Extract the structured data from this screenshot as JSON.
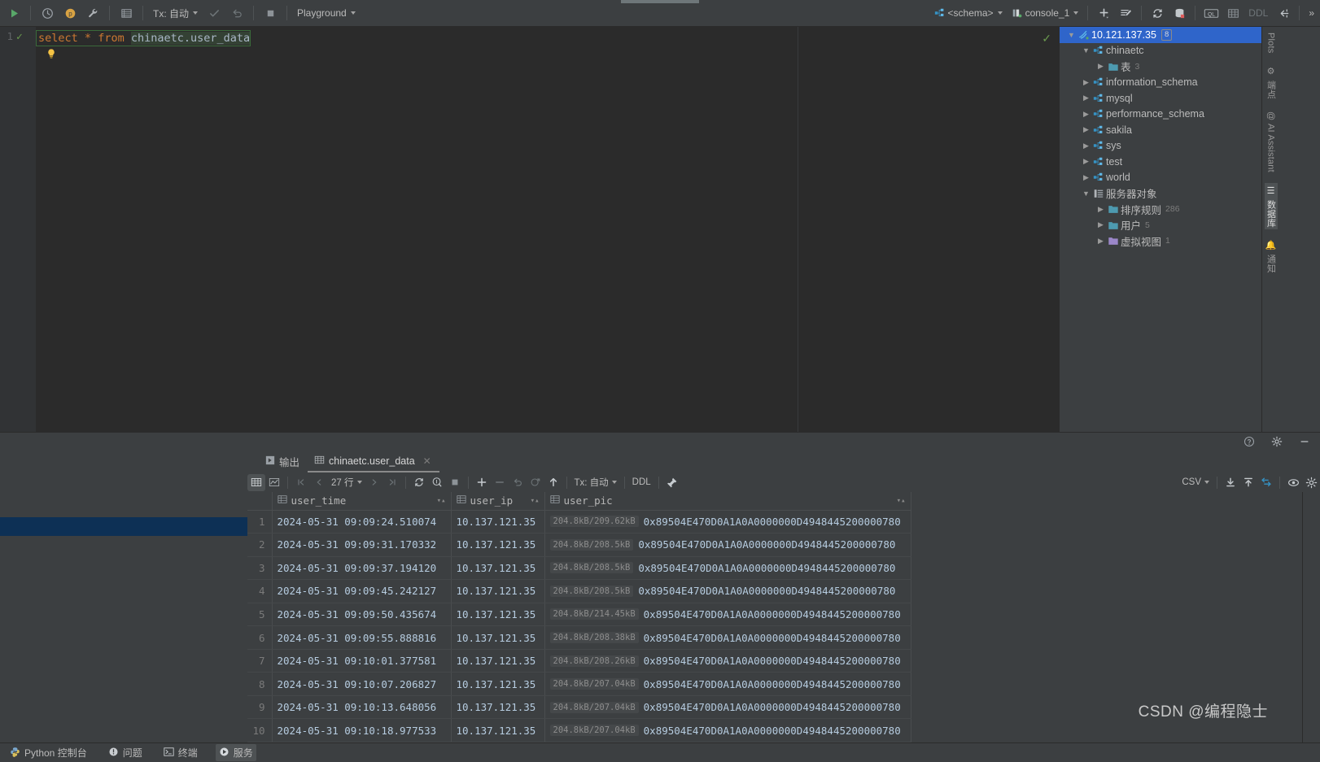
{
  "colors": {
    "accent_blue": "#2f65ca",
    "panel_bg": "#3c3f41",
    "editor_bg": "#2b2b2b",
    "selection_row": "#0d3055",
    "keyword_orange": "#cc7832",
    "text": "#bbbbbb",
    "green_ok": "#6a9a4e",
    "blue_icon": "#3592c4"
  },
  "toolbar": {
    "run_icon": "run-icon",
    "history_icon": "history-icon",
    "profiler_icon": "profiler-icon",
    "wrench_icon": "wrench-icon",
    "table_icon": "data-editor-icon",
    "tx_label": "Tx: 自动",
    "commit_icon": "commit-icon",
    "rollback_icon": "rollback-icon",
    "stop_icon": "stop-icon",
    "session_label": "Playground",
    "schema_label": "<schema>",
    "console_label": "console_1",
    "add_icon": "add-icon",
    "query_icon": "new-query-icon",
    "sync_icon": "refresh-icon",
    "db_icon": "database-icon",
    "ql_icon": "ql-icon",
    "grid_icon": "grid-icon",
    "ddl_label": "DDL",
    "jump_icon": "jump-to-console-icon",
    "more_label": "»"
  },
  "editor": {
    "line_number": "1",
    "code": {
      "kw_select": "select",
      "star": "*",
      "kw_from": "from",
      "table": "chinaetc.user_data"
    },
    "bulb_icon": "intention-bulb-icon",
    "inspection_ok_icon": "inspection-ok-icon"
  },
  "db_tree": {
    "root": {
      "label": "10.121.137.35",
      "badge": "8",
      "icon": "datasource-mysql-icon",
      "expanded": true
    },
    "items": [
      {
        "label": "chinaetc",
        "icon": "schema-icon",
        "indent": 1,
        "expanded": true,
        "count": ""
      },
      {
        "label": "表",
        "icon": "folder-icon",
        "indent": 2,
        "expanded": false,
        "count": "3"
      },
      {
        "label": "information_schema",
        "icon": "schema-icon",
        "indent": 1,
        "expanded": false,
        "count": ""
      },
      {
        "label": "mysql",
        "icon": "schema-icon",
        "indent": 1,
        "expanded": false,
        "count": ""
      },
      {
        "label": "performance_schema",
        "icon": "schema-icon",
        "indent": 1,
        "expanded": false,
        "count": ""
      },
      {
        "label": "sakila",
        "icon": "schema-icon",
        "indent": 1,
        "expanded": false,
        "count": ""
      },
      {
        "label": "sys",
        "icon": "schema-icon",
        "indent": 1,
        "expanded": false,
        "count": ""
      },
      {
        "label": "test",
        "icon": "schema-icon",
        "indent": 1,
        "expanded": false,
        "count": ""
      },
      {
        "label": "world",
        "icon": "schema-icon",
        "indent": 1,
        "expanded": false,
        "count": ""
      },
      {
        "label": "服务器对象",
        "icon": "server-objects-icon",
        "indent": 1,
        "expanded": true,
        "count": ""
      },
      {
        "label": "排序规则",
        "icon": "folder-icon",
        "indent": 2,
        "expanded": false,
        "count": "286"
      },
      {
        "label": "用户",
        "icon": "folder-icon",
        "indent": 2,
        "expanded": false,
        "count": "5"
      },
      {
        "label": "虚拟视图",
        "icon": "folder-purple-icon",
        "indent": 2,
        "expanded": false,
        "count": "1"
      }
    ]
  },
  "right_strip": [
    {
      "label": "Plots",
      "icon": "plots-icon",
      "active": false
    },
    {
      "label": "端点",
      "icon": "endpoints-icon",
      "active": false
    },
    {
      "label": "AI Assistant",
      "icon": "ai-icon",
      "active": false
    },
    {
      "label": "数据库",
      "icon": "database-icon",
      "active": true
    },
    {
      "label": "通知",
      "icon": "notification-icon",
      "active": false
    }
  ],
  "bottom_panel": {
    "settings_icon": "settings-gear-icon",
    "help_icon": "help-icon",
    "minimize_icon": "minimize-icon",
    "tabs": [
      {
        "label": "输出",
        "icon": "output-icon",
        "active": false,
        "closable": false
      },
      {
        "label": "chinaetc.user_data",
        "icon": "table-icon",
        "active": true,
        "closable": true
      }
    ],
    "grid_toolbar": {
      "grid_view_icon": "grid-view-icon",
      "chart_view_icon": "chart-view-icon",
      "first_page_icon": "first-page-icon",
      "prev_page_icon": "prev-page-icon",
      "rows_label": "27 行",
      "next_page_icon": "next-page-icon",
      "last_page_icon": "last-page-icon",
      "reload_icon": "reload-icon",
      "page_size_icon": "page-size-icon",
      "stop_icon": "stop-icon",
      "add_row_icon": "add-row-icon",
      "delete_row_icon": "delete-row-icon",
      "revert_icon": "revert-icon",
      "revert_selected_icon": "revert-selected-icon",
      "submit_icon": "submit-icon",
      "tx_label": "Tx: 自动",
      "ddl_label": "DDL",
      "pin_icon": "pin-icon",
      "format_label": "CSV",
      "export_icon": "export-icon",
      "import_icon": "import-icon",
      "compare_icon": "compare-icon",
      "view_icon": "view-options-icon",
      "settings_icon": "grid-settings-icon"
    },
    "table": {
      "columns": [
        {
          "name": "user_time",
          "icon": "column-icon",
          "sortable": true
        },
        {
          "name": "user_ip",
          "icon": "column-icon",
          "sortable": true
        },
        {
          "name": "user_pic",
          "icon": "column-icon",
          "sortable": false
        }
      ],
      "rows": [
        {
          "n": "1",
          "user_time": "2024-05-31 09:09:24.510074",
          "user_ip": "10.137.121.35",
          "pic_size": "204.8kB/209.62kB",
          "pic_hex": "0x89504E470D0A1A0A0000000D4948445200000780"
        },
        {
          "n": "2",
          "user_time": "2024-05-31 09:09:31.170332",
          "user_ip": "10.137.121.35",
          "pic_size": "204.8kB/208.5kB",
          "pic_hex": "0x89504E470D0A1A0A0000000D4948445200000780"
        },
        {
          "n": "3",
          "user_time": "2024-05-31 09:09:37.194120",
          "user_ip": "10.137.121.35",
          "pic_size": "204.8kB/208.5kB",
          "pic_hex": "0x89504E470D0A1A0A0000000D4948445200000780"
        },
        {
          "n": "4",
          "user_time": "2024-05-31 09:09:45.242127",
          "user_ip": "10.137.121.35",
          "pic_size": "204.8kB/208.5kB",
          "pic_hex": "0x89504E470D0A1A0A0000000D4948445200000780"
        },
        {
          "n": "5",
          "user_time": "2024-05-31 09:09:50.435674",
          "user_ip": "10.137.121.35",
          "pic_size": "204.8kB/214.45kB",
          "pic_hex": "0x89504E470D0A1A0A0000000D4948445200000780"
        },
        {
          "n": "6",
          "user_time": "2024-05-31 09:09:55.888816",
          "user_ip": "10.137.121.35",
          "pic_size": "204.8kB/208.38kB",
          "pic_hex": "0x89504E470D0A1A0A0000000D4948445200000780"
        },
        {
          "n": "7",
          "user_time": "2024-05-31 09:10:01.377581",
          "user_ip": "10.137.121.35",
          "pic_size": "204.8kB/208.26kB",
          "pic_hex": "0x89504E470D0A1A0A0000000D4948445200000780"
        },
        {
          "n": "8",
          "user_time": "2024-05-31 09:10:07.206827",
          "user_ip": "10.137.121.35",
          "pic_size": "204.8kB/207.04kB",
          "pic_hex": "0x89504E470D0A1A0A0000000D4948445200000780"
        },
        {
          "n": "9",
          "user_time": "2024-05-31 09:10:13.648056",
          "user_ip": "10.137.121.35",
          "pic_size": "204.8kB/207.04kB",
          "pic_hex": "0x89504E470D0A1A0A0000000D4948445200000780"
        },
        {
          "n": "10",
          "user_time": "2024-05-31 09:10:18.977533",
          "user_ip": "10.137.121.35",
          "pic_size": "204.8kB/207.04kB",
          "pic_hex": "0x89504E470D0A1A0A0000000D4948445200000780"
        }
      ]
    }
  },
  "status_bar": {
    "items": [
      {
        "label": "Python 控制台",
        "icon": "python-icon",
        "active": false
      },
      {
        "label": "问题",
        "icon": "problems-icon",
        "active": false
      },
      {
        "label": "终端",
        "icon": "terminal-icon",
        "active": false
      },
      {
        "label": "服务",
        "icon": "services-icon",
        "active": true
      }
    ]
  },
  "watermark": "CSDN @编程隐士"
}
